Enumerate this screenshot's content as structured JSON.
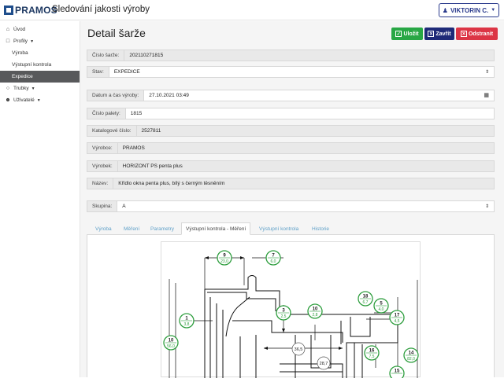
{
  "brand": {
    "logo": "PRAMOS",
    "app_title": "Sledování jakosti výroby"
  },
  "user": {
    "label": "VIKTORIN C.",
    "icon": "user-icon"
  },
  "sidebar": {
    "items": [
      {
        "label": "Úvod",
        "icon": "home-icon"
      },
      {
        "label": "Profily",
        "icon": "square-icon"
      },
      {
        "label": "Výroba"
      },
      {
        "label": "Výstupní kontrola"
      },
      {
        "label": "Expedice"
      },
      {
        "label": "Trubky",
        "icon": "circle-icon"
      },
      {
        "label": "Uživatelé",
        "icon": "users-icon"
      }
    ]
  },
  "page": {
    "title": "Detail šarže"
  },
  "toolbar": {
    "save_label": "Uložit",
    "close_label": "Zavřít",
    "delete_label": "Odstranit"
  },
  "fields": {
    "cislo_sarze": {
      "label": "Číslo šarže:",
      "value": "202110271815"
    },
    "stav": {
      "label": "Stav:",
      "value": "EXPEDICE"
    },
    "datum": {
      "label": "Datum a čas výroby:",
      "value": "27.10.2021 03:49"
    },
    "cislo_palety": {
      "label": "Číslo palety:",
      "value": "1815"
    },
    "katalogove": {
      "label": "Katalogové číslo:",
      "value": "2527811"
    },
    "vyrobce": {
      "label": "Výrobce:",
      "value": "PRAMOS"
    },
    "vyrobek": {
      "label": "Výrobek:",
      "value": "HORIZONT PS penta plus"
    },
    "nazev": {
      "label": "Název:",
      "value": "Křídlo okna penta plus, bílý s černým těsněním"
    },
    "skupina": {
      "label": "Skupina:",
      "value": "A"
    }
  },
  "tabs": [
    {
      "label": "Výroba"
    },
    {
      "label": "Měření"
    },
    {
      "label": "Parametry"
    },
    {
      "label": "Výstupní kontrola - Měření"
    },
    {
      "label": "Výstupní kontrola"
    },
    {
      "label": "Historie"
    }
  ],
  "drawing": {
    "markers": [
      {
        "num": "9",
        "val": "23,0"
      },
      {
        "num": "7",
        "val": "6,0"
      },
      {
        "num": "1",
        "val": "3,8"
      },
      {
        "num": "10",
        "val": "56,0"
      },
      {
        "num": "3",
        "val": "2,5"
      },
      {
        "num": "10",
        "val": "2,8"
      },
      {
        "num": "18",
        "val": "6,7"
      },
      {
        "num": "5",
        "val": "4,0"
      },
      {
        "num": "17",
        "val": "4,5"
      },
      {
        "num": "16",
        "val": "7,5"
      },
      {
        "num": "14",
        "val": "82,0"
      },
      {
        "num": "15",
        "val": ""
      }
    ],
    "dims": [
      "36,5",
      "28,7"
    ]
  },
  "colors": {
    "success": "#28a745",
    "primary": "#1e2a78",
    "danger": "#dc3545",
    "marker": "#2e9e3e"
  }
}
